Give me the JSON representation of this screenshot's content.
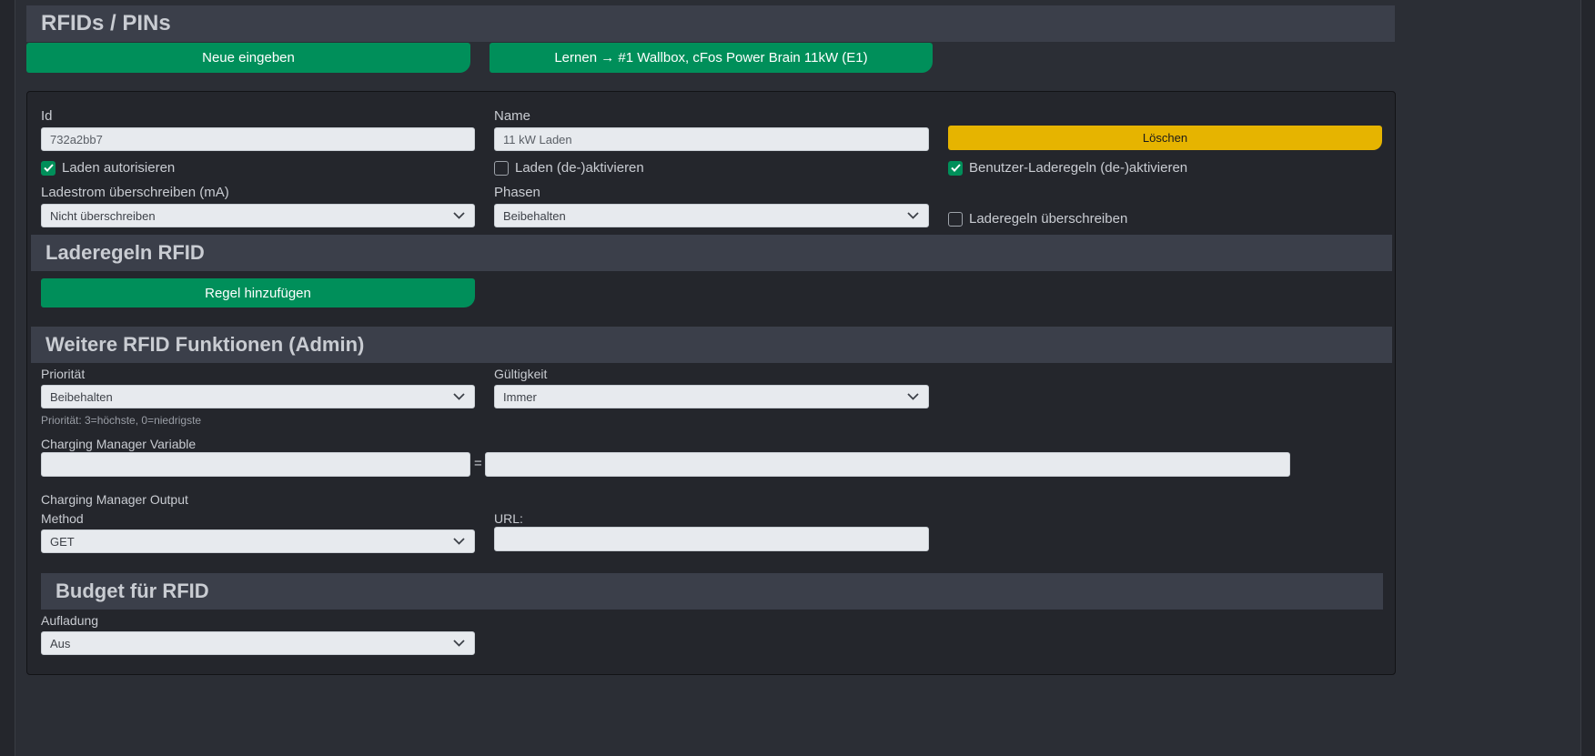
{
  "sections": {
    "rfids_title": "RFIDs / PINs",
    "laderegeln_title": "Laderegeln RFID",
    "weitere_title": "Weitere RFID Funktionen (Admin)",
    "budget_title": "Budget für RFID"
  },
  "toolbar": {
    "new_label": "Neue eingeben",
    "learn_label": "Lernen → #1 Wallbox, cFos Power Brain 11kW (E1)"
  },
  "form": {
    "id_label": "Id",
    "id_value": "732a2bb7",
    "name_label": "Name",
    "name_value": "11 kW Laden",
    "delete_label": "Löschen",
    "cb_authorize": {
      "label": "Laden autorisieren",
      "checked": true
    },
    "cb_deactivate": {
      "label": "Laden (de-)aktivieren",
      "checked": false
    },
    "cb_user_rules": {
      "label": "Benutzer-Laderegeln (de-)aktivieren",
      "checked": true
    },
    "cb_override_rules": {
      "label": "Laderegeln überschreiben",
      "checked": false
    },
    "current_label": "Ladestrom überschreiben (mA)",
    "current_value": "Nicht überschreiben",
    "phases_label": "Phasen",
    "phases_value": "Beibehalten"
  },
  "rules": {
    "add_label": "Regel hinzufügen"
  },
  "admin": {
    "priority_label": "Priorität",
    "priority_value": "Beibehalten",
    "priority_hint": "Priorität: 3=höchste, 0=niedrigste",
    "validity_label": "Gültigkeit",
    "validity_value": "Immer",
    "cm_variable_label": "Charging Manager Variable",
    "cm_variable_name": "",
    "cm_variable_value": "",
    "equals": "=",
    "cm_output_label": "Charging Manager Output",
    "method_label": "Method",
    "method_value": "GET",
    "url_label": "URL:",
    "url_value": ""
  },
  "budget": {
    "charge_label": "Aufladung",
    "charge_value": "Aus"
  },
  "colors": {
    "accent_green": "#008f5a",
    "delete_yellow": "#e6b400",
    "background": "#24262c",
    "header_bg": "#3b3f4a"
  }
}
